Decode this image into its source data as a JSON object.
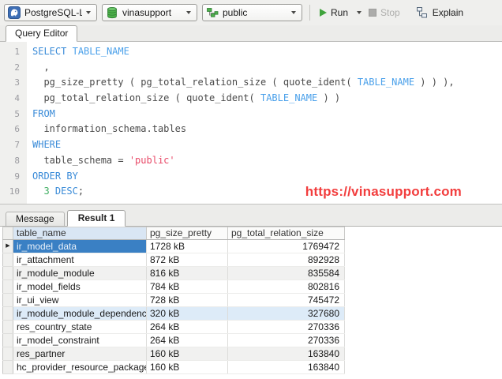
{
  "toolbar": {
    "connection_label": "PostgreSQL-Local",
    "database_label": "vinasupport",
    "schema_label": "public",
    "run_label": "Run",
    "stop_label": "Stop",
    "explain_label": "Explain"
  },
  "editor": {
    "tab_label": "Query Editor",
    "watermark": "https://vinasupport.com",
    "lines": [
      {
        "n": "1",
        "seg": [
          [
            "SELECT",
            "kw"
          ],
          [
            " ",
            "pl"
          ],
          [
            "TABLE_NAME",
            "id"
          ]
        ]
      },
      {
        "n": "2",
        "seg": [
          [
            "  ,",
            "pl"
          ]
        ]
      },
      {
        "n": "3",
        "seg": [
          [
            "  pg_size_pretty ( pg_total_relation_size ( quote_ident( ",
            "pl"
          ],
          [
            "TABLE_NAME",
            "id"
          ],
          [
            " ) ) ),",
            "pl"
          ]
        ]
      },
      {
        "n": "4",
        "seg": [
          [
            "  pg_total_relation_size ( quote_ident( ",
            "pl"
          ],
          [
            "TABLE_NAME",
            "id"
          ],
          [
            " ) )",
            "pl"
          ]
        ]
      },
      {
        "n": "5",
        "seg": [
          [
            "FROM",
            "kw"
          ]
        ]
      },
      {
        "n": "6",
        "seg": [
          [
            "  information_schema.tables",
            "pl"
          ]
        ]
      },
      {
        "n": "7",
        "seg": [
          [
            "WHERE",
            "kw"
          ]
        ]
      },
      {
        "n": "8",
        "seg": [
          [
            "  table_schema = ",
            "pl"
          ],
          [
            "'public'",
            "str"
          ]
        ]
      },
      {
        "n": "9",
        "seg": [
          [
            "ORDER BY",
            "kw"
          ]
        ]
      },
      {
        "n": "10",
        "seg": [
          [
            "  ",
            "pl"
          ],
          [
            "3",
            "num"
          ],
          [
            " ",
            "pl"
          ],
          [
            "DESC",
            "kw"
          ],
          [
            ";",
            "pl"
          ]
        ]
      }
    ]
  },
  "results": {
    "tabs": [
      {
        "label": "Message",
        "active": false
      },
      {
        "label": "Result 1",
        "active": true
      }
    ],
    "columns": [
      "table_name",
      "pg_size_pretty",
      "pg_total_relation_size"
    ],
    "rows": [
      {
        "cells": [
          "ir_model_data",
          "1728 kB",
          "1769472"
        ],
        "style": "selected"
      },
      {
        "cells": [
          "ir_attachment",
          "872 kB",
          "892928"
        ],
        "style": ""
      },
      {
        "cells": [
          "ir_module_module",
          "816 kB",
          "835584"
        ],
        "style": "gray"
      },
      {
        "cells": [
          "ir_model_fields",
          "784 kB",
          "802816"
        ],
        "style": ""
      },
      {
        "cells": [
          "ir_ui_view",
          "728 kB",
          "745472"
        ],
        "style": ""
      },
      {
        "cells": [
          "ir_module_module_dependency",
          "320 kB",
          "327680"
        ],
        "style": "blue"
      },
      {
        "cells": [
          "res_country_state",
          "264 kB",
          "270336"
        ],
        "style": ""
      },
      {
        "cells": [
          "ir_model_constraint",
          "264 kB",
          "270336"
        ],
        "style": ""
      },
      {
        "cells": [
          "res_partner",
          "160 kB",
          "163840"
        ],
        "style": "gray"
      },
      {
        "cells": [
          "hc_provider_resource_package",
          "160 kB",
          "163840"
        ],
        "style": ""
      }
    ],
    "selected_row_marker": "▶"
  },
  "colors": {
    "keyword_blue": "#3a8bd8",
    "identifier_blue": "#4aa0ea",
    "string_red": "#e84a68",
    "number_green": "#3fae62",
    "plain_code": "#4a4a4a",
    "selection_blue": "#3a80c4",
    "row_highlight_blue": "#ddebf8",
    "watermark_red": "#f23d3d",
    "icon_green": "#3fa33c",
    "postgres_blue": "#3d6eb5"
  }
}
